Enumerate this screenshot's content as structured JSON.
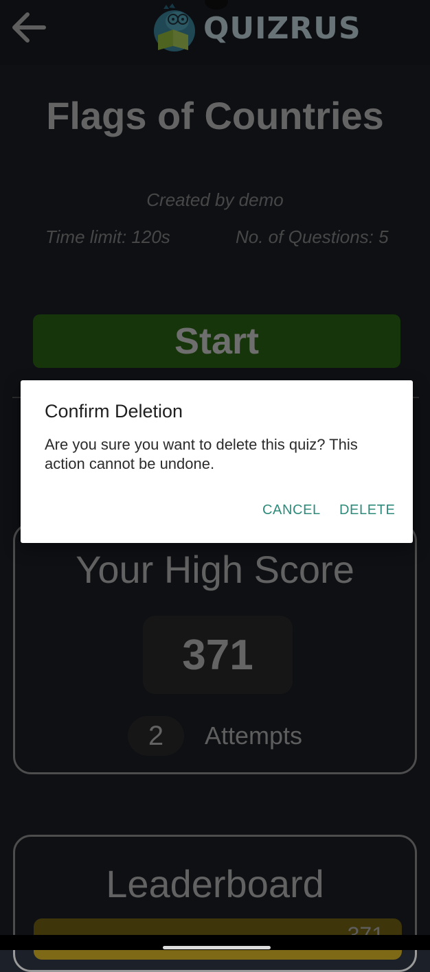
{
  "app": {
    "logo_text": "QUIZRUS",
    "logo_icon": "dinosaur-reading-book-icon",
    "back_icon": "arrow-left-icon"
  },
  "quiz": {
    "title": "Flags of Countries",
    "creator": "Created by demo",
    "time_limit": "Time limit: 120s",
    "num_questions": "No. of Questions: 5",
    "start_label": "Start"
  },
  "high_score": {
    "title": "Your High Score",
    "score": "371",
    "attempts_count": "2",
    "attempts_label": "Attempts"
  },
  "leaderboard": {
    "title": "Leaderboard",
    "first_score_partial": "371"
  },
  "dialog": {
    "title": "Confirm Deletion",
    "message": "Are you sure you want to delete this quiz? This action cannot be undone.",
    "cancel_label": "CANCEL",
    "delete_label": "DELETE"
  },
  "colors": {
    "background": "#1c2029",
    "start_button": "#2e6a14",
    "dialog_accent": "#2e8a7a",
    "leaderboard_first": "#7e6a16"
  }
}
